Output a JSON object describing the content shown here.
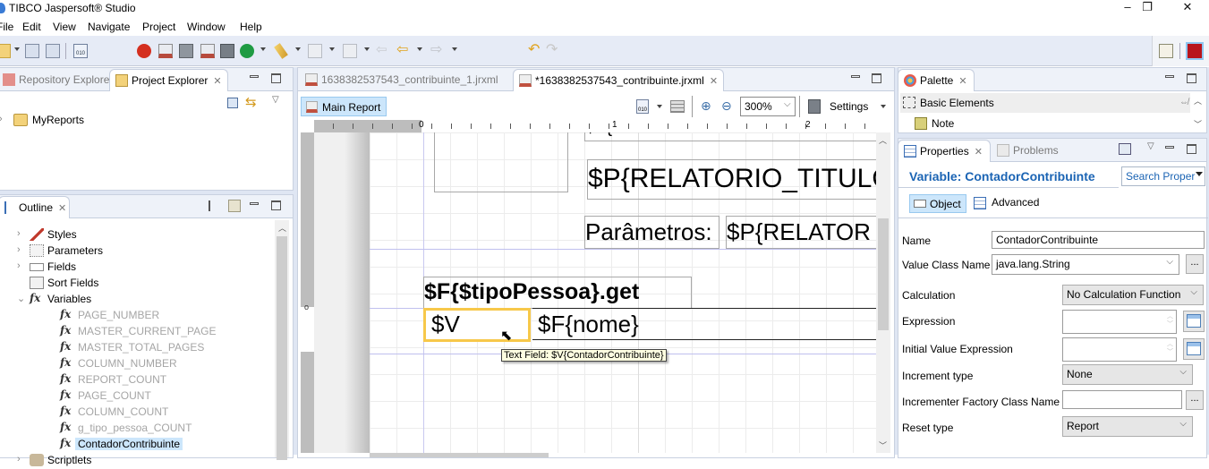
{
  "window": {
    "title": "TIBCO Jaspersoft® Studio",
    "minimize_label": "–",
    "restore_label": "❐",
    "close_label": "✕"
  },
  "menu": {
    "items": [
      "File",
      "Edit",
      "View",
      "Navigate",
      "Project",
      "Window",
      "Help"
    ]
  },
  "toolbar": {
    "icons": [
      "new-icon",
      "save-icon",
      "save-all-icon",
      "compile-icon",
      "debug-icon",
      "new-report-icon",
      "new-data-adapter-icon",
      "new-wizard-icon",
      "publish-icon",
      "run-icon",
      "pencil-icon",
      "next-annotation-icon",
      "prev-annotation-icon",
      "back-nav-icon",
      "back-icon",
      "forward-icon",
      "undo-icon",
      "redo-icon"
    ],
    "perspective_icons": [
      "open-perspective-icon",
      "report-design-perspective-icon"
    ]
  },
  "explorer": {
    "tabs": [
      {
        "label": "Repository Explorer",
        "active": false
      },
      {
        "label": "Project Explorer",
        "active": true
      }
    ],
    "close_glyph": "✕",
    "tree": [
      {
        "label": "MyReports",
        "icon": "folder-icon",
        "expandable": true
      }
    ]
  },
  "outline": {
    "tab_label": "Outline",
    "close_glyph": "✕",
    "tree": [
      {
        "label": "Styles",
        "icon": "styles-icon",
        "chevron": "›",
        "level": 0
      },
      {
        "label": "Parameters",
        "icon": "parameters-icon",
        "chevron": "›",
        "level": 0
      },
      {
        "label": "Fields",
        "icon": "fields-icon",
        "chevron": "›",
        "level": 0
      },
      {
        "label": "Sort Fields",
        "icon": "sort-fields-icon",
        "chevron": "",
        "level": 0
      },
      {
        "label": "Variables",
        "icon": "fx-icon",
        "chevron": "⌄",
        "level": 0
      },
      {
        "label": "PAGE_NUMBER",
        "icon": "fx-icon",
        "level": 1,
        "builtin": true
      },
      {
        "label": "MASTER_CURRENT_PAGE",
        "icon": "fx-icon",
        "level": 1,
        "builtin": true
      },
      {
        "label": "MASTER_TOTAL_PAGES",
        "icon": "fx-icon",
        "level": 1,
        "builtin": true
      },
      {
        "label": "COLUMN_NUMBER",
        "icon": "fx-icon",
        "level": 1,
        "builtin": true
      },
      {
        "label": "REPORT_COUNT",
        "icon": "fx-icon",
        "level": 1,
        "builtin": true
      },
      {
        "label": "PAGE_COUNT",
        "icon": "fx-icon",
        "level": 1,
        "builtin": true
      },
      {
        "label": "COLUMN_COUNT",
        "icon": "fx-icon",
        "level": 1,
        "builtin": true
      },
      {
        "label": "g_tipo_pessoa_COUNT",
        "icon": "fx-icon",
        "level": 1,
        "builtin": true
      },
      {
        "label": "ContadorContribuinte",
        "icon": "fx-icon",
        "level": 1,
        "selected": true
      },
      {
        "label": "Scriptlets",
        "icon": "scriptlets-icon",
        "chevron": "›",
        "level": 0
      }
    ],
    "fx_glyph": "fx"
  },
  "editor": {
    "tabs": [
      {
        "label": "1638382537543_contribuinte_1.jrxml",
        "active": false
      },
      {
        "label": "*1638382537543_contribuinte.jrxml",
        "active": true
      }
    ],
    "close_glyph": "✕",
    "main_report_label": "Main Report",
    "zoom_value": "300%",
    "settings_label": "Settings",
    "ruler_labels": [
      "0",
      "1",
      "2"
    ],
    "canvas": {
      "title_field_top": "$F{",
      "title_param": "$P{RELATORIO_TITULO",
      "params_label": "Parâmetros:",
      "params_value": "$P{RELATOR",
      "group_header": "$F{$tipoPessoa}.get",
      "counter_field": "$V",
      "name_field": "$F{nome}",
      "tooltip": "Text Field: $V{ContadorContribuinte}"
    }
  },
  "palette": {
    "tab_label": "Palette",
    "close_glyph": "✕",
    "section_label": "Basic Elements",
    "items": [
      {
        "label": "Note",
        "icon": "note-icon"
      }
    ]
  },
  "properties": {
    "tabs": [
      {
        "label": "Properties",
        "active": true
      },
      {
        "label": "Problems",
        "active": false
      }
    ],
    "close_glyph": "✕",
    "heading": "Variable: ContadorContribuinte",
    "search_placeholder": "Search Proper",
    "subtabs": [
      {
        "label": "Object",
        "active": true
      },
      {
        "label": "Advanced",
        "active": false
      }
    ],
    "fields": {
      "name_label": "Name",
      "name_value": "ContadorContribuinte",
      "value_class_label": "Value Class Name",
      "value_class_value": "java.lang.String",
      "calculation_label": "Calculation",
      "calculation_value": "No Calculation Function",
      "expression_label": "Expression",
      "expression_value": "",
      "initial_value_label": "Initial Value Expression",
      "initial_value_value": "",
      "increment_type_label": "Increment type",
      "increment_type_value": "None",
      "incrementer_factory_label": "Incrementer Factory Class Name",
      "incrementer_factory_value": "",
      "reset_type_label": "Reset type",
      "reset_type_value": "Report"
    },
    "dots_label": "..."
  },
  "colors": {
    "accent_heading": "#1b64b4",
    "selection": "#cce6fb",
    "tooltip_bg": "#ffffe1",
    "selected_element_border": "#f7c84a"
  }
}
